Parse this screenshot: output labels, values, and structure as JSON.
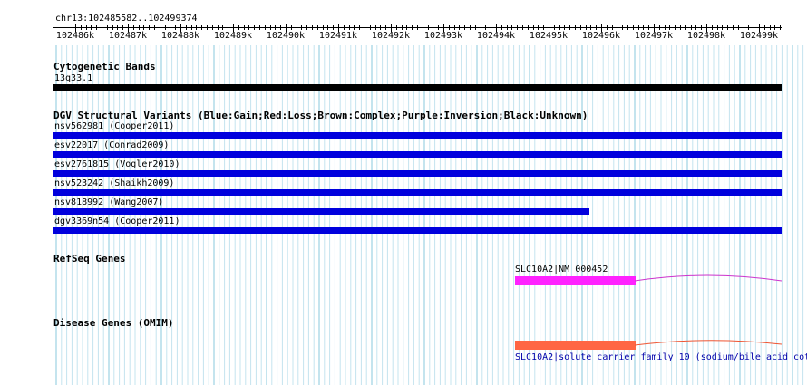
{
  "ruler": {
    "location": "chr13:102485582..102499374",
    "ticks": [
      "102486k",
      "102487k",
      "102488k",
      "102489k",
      "102490k",
      "102491k",
      "102492k",
      "102493k",
      "102494k",
      "102495k",
      "102496k",
      "102497k",
      "102498k",
      "102499k"
    ]
  },
  "cytoband": {
    "title": "Cytogenetic Bands",
    "label": "13q33.1",
    "color": "#000000"
  },
  "dgv": {
    "title": "DGV Structural Variants (Blue:Gain;Red:Loss;Brown:Complex;Purple:Inversion;Black:Unknown)",
    "color": "#0000dd",
    "variants": [
      {
        "label": "nsv562981 (Cooper2011)",
        "span": "full"
      },
      {
        "label": "esv22017 (Conrad2009)",
        "span": "full"
      },
      {
        "label": "esv2761815 (Vogler2010)",
        "span": "full"
      },
      {
        "label": "nsv523242 (Shaikh2009)",
        "span": "full"
      },
      {
        "label": "nsv818992 (Wang2007)",
        "span": "partial"
      },
      {
        "label": "dgv3369n54 (Cooper2011)",
        "span": "full"
      }
    ]
  },
  "refseq": {
    "title": "RefSeq Genes",
    "gene_label": "SLC10A2|NM_000452",
    "color": "#ff22ff",
    "line_color": "#cc33cc"
  },
  "omim": {
    "title": "Disease Genes (OMIM)",
    "gene_label": "SLC10A2|solute carrier family 10 (sodium/bile acid cot",
    "color": "#ff6644",
    "line_color": "#ee5533"
  }
}
